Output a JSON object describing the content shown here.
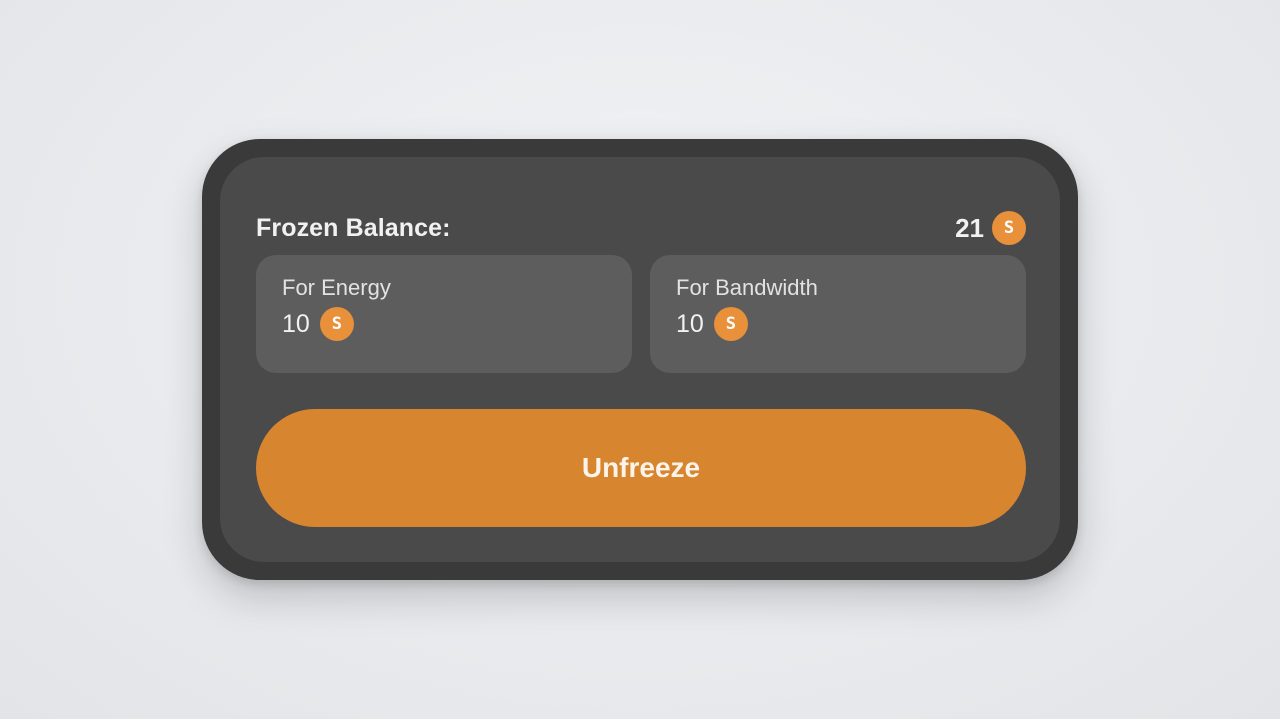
{
  "balance": {
    "title": "Frozen Balance:",
    "total": "21",
    "coin_icon": "tron-coin-icon",
    "coin_glyph": "S"
  },
  "cards": [
    {
      "label": "For Energy",
      "amount": "10"
    },
    {
      "label": "For Bandwidth",
      "amount": "10"
    }
  ],
  "actions": {
    "unfreeze_label": "Unfreeze"
  },
  "colors": {
    "accent": "#d88530",
    "coin": "#e8903a",
    "panel": "#4a4a4b",
    "card": "#5d5d5e",
    "frame": "#3a3a3b"
  }
}
